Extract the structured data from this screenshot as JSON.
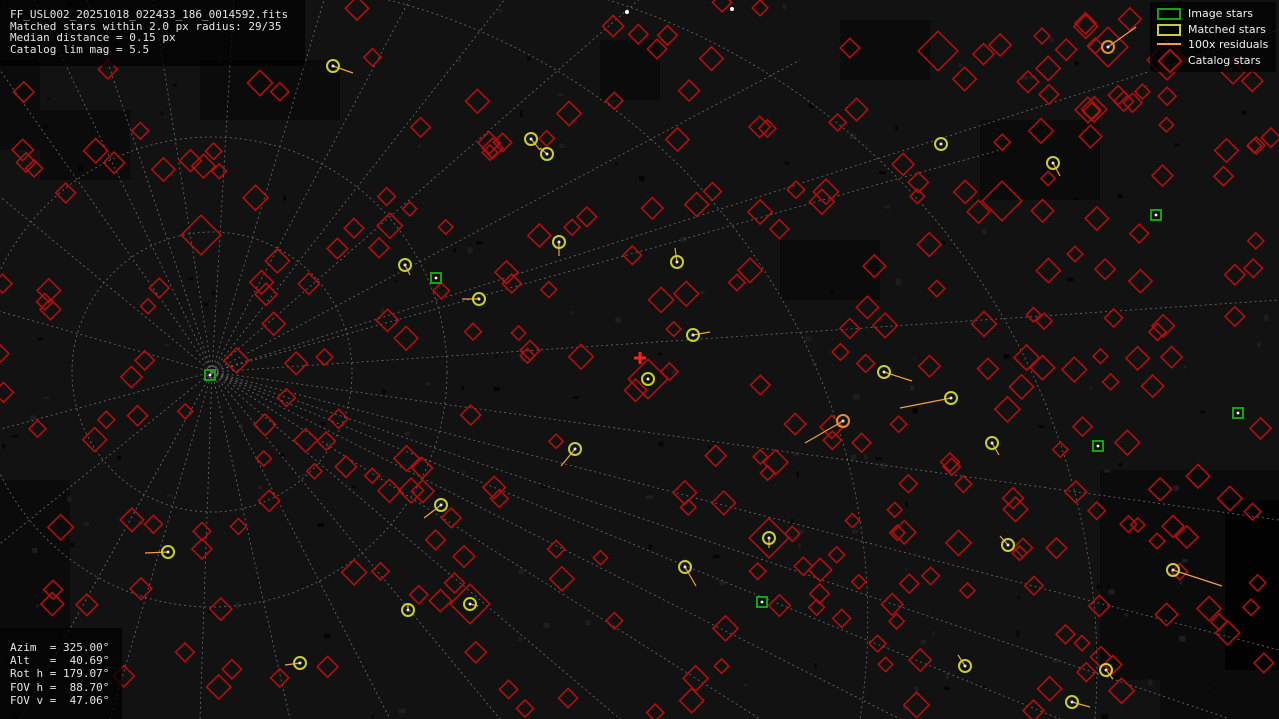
{
  "header_info": {
    "filename": "FF_USL002_20251018_022433_186_0014592.fits",
    "matched": "Matched stars within 2.0 px radius: 29/35",
    "median": "Median distance = 0.15 px",
    "catalog": "Catalog lim mag = 5.5"
  },
  "legend": {
    "image_stars": "Image stars",
    "matched_stars": "Matched stars",
    "residuals": "100x residuals",
    "catalog_stars": "Catalog stars"
  },
  "pointing": {
    "azim": "Azim  = 325.00°",
    "alt": "Alt   =  40.69°",
    "rot": "Rot h = 179.07°",
    "fovh": "FOV h =  88.70°",
    "fovv": "FOV v =  47.06°"
  },
  "colors": {
    "background": "#121212",
    "catalog_star": "#b01010",
    "image_star": "#13a413",
    "matched_star": "#c8cf2e",
    "residual": "#f0a04a",
    "center_cross": "#ff2020",
    "grid": "#6e6e6e"
  },
  "matched_stars": [
    {
      "id": "ms-01"
    },
    {
      "id": "ms-02"
    },
    {
      "id": "ms-03"
    },
    {
      "id": "ms-04"
    },
    {
      "id": "ms-05"
    },
    {
      "id": "ms-06"
    },
    {
      "id": "ms-07"
    },
    {
      "id": "ms-08"
    },
    {
      "id": "ms-09"
    },
    {
      "id": "ms-10"
    },
    {
      "id": "ms-11"
    },
    {
      "id": "ms-12"
    },
    {
      "id": "ms-13"
    },
    {
      "id": "ms-14"
    },
    {
      "id": "ms-15"
    },
    {
      "id": "ms-16"
    },
    {
      "id": "ms-17"
    },
    {
      "id": "ms-18"
    },
    {
      "id": "ms-19"
    },
    {
      "id": "ms-20"
    },
    {
      "id": "ms-21"
    },
    {
      "id": "ms-22"
    },
    {
      "id": "ms-23"
    },
    {
      "id": "ms-24"
    },
    {
      "id": "ms-25"
    },
    {
      "id": "ms-26"
    },
    {
      "id": "ms-27"
    },
    {
      "id": "ms-28"
    },
    {
      "id": "ms-29"
    }
  ],
  "unmatched_image_stars": [
    {
      "id": "is-01"
    },
    {
      "id": "is-02"
    },
    {
      "id": "is-03"
    },
    {
      "id": "is-04"
    },
    {
      "id": "is-05"
    },
    {
      "id": "is-06"
    }
  ]
}
